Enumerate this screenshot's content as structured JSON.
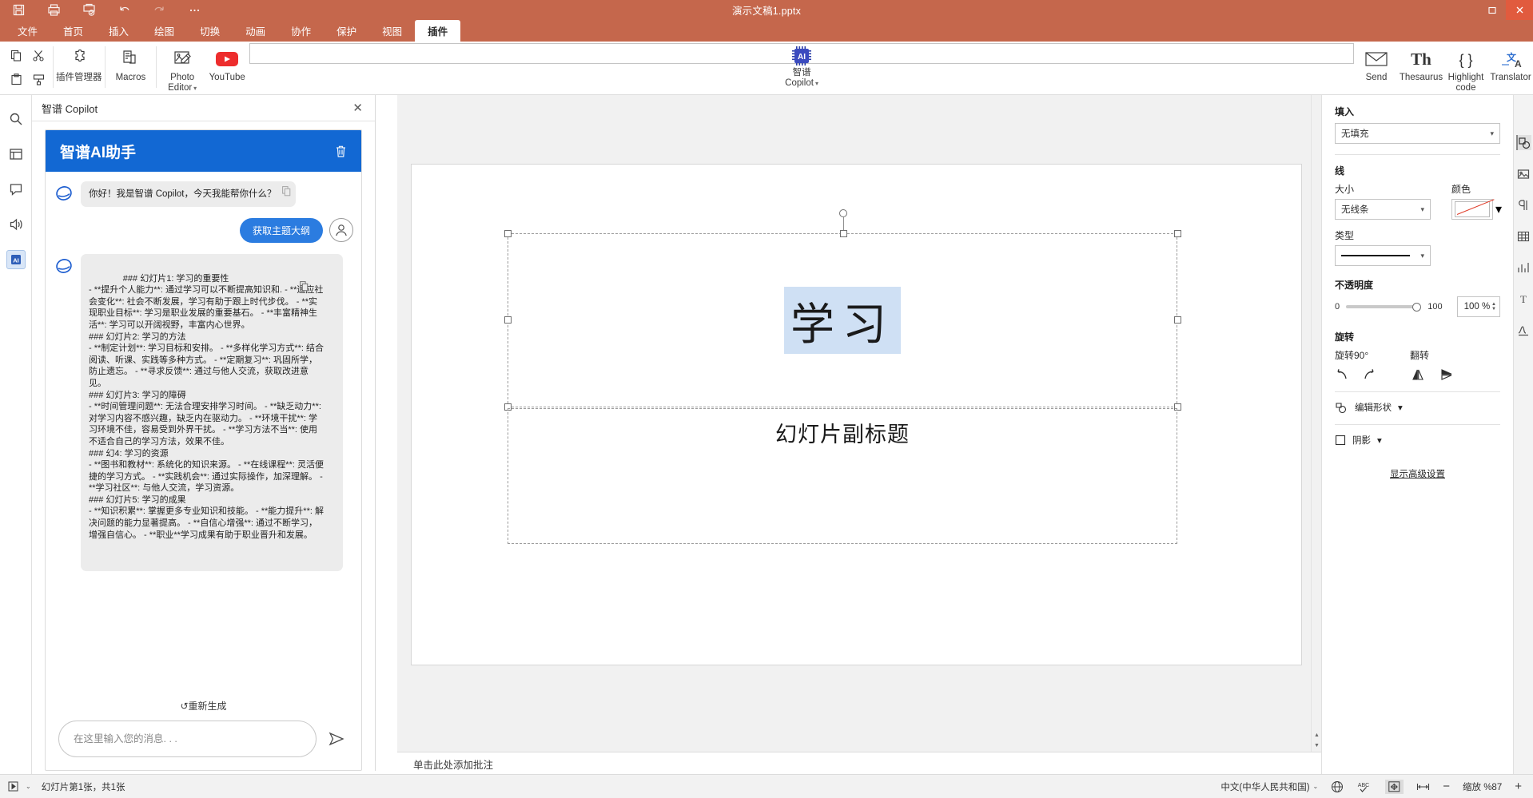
{
  "titlebar": {
    "document_title": "演示文稿1.pptx",
    "quick_access": [
      {
        "name": "save-icon",
        "label": "保存"
      },
      {
        "name": "print-icon",
        "label": "打印"
      },
      {
        "name": "print-preview-icon",
        "label": "打印预览"
      },
      {
        "name": "undo-icon",
        "label": "撤销"
      },
      {
        "name": "redo-icon",
        "label": "重做"
      },
      {
        "name": "more-icon",
        "label": "更多"
      }
    ],
    "window_buttons": [
      {
        "name": "restore-icon",
        "label": "还原"
      },
      {
        "name": "close-icon",
        "label": "关闭"
      }
    ]
  },
  "menu_tabs": [
    {
      "label": "文件",
      "active": false
    },
    {
      "label": "首页",
      "active": false
    },
    {
      "label": "插入",
      "active": false
    },
    {
      "label": "绘图",
      "active": false
    },
    {
      "label": "切换",
      "active": false
    },
    {
      "label": "动画",
      "active": false
    },
    {
      "label": "协作",
      "active": false
    },
    {
      "label": "保护",
      "active": false
    },
    {
      "label": "视图",
      "active": false
    },
    {
      "label": "插件",
      "active": true
    }
  ],
  "ribbon": {
    "clipboard": [
      {
        "name": "copy-icon",
        "label": "复制"
      },
      {
        "name": "cut-icon",
        "label": "剪切"
      },
      {
        "name": "paste-icon",
        "label": "粘贴"
      },
      {
        "name": "format-painter-icon",
        "label": "格式刷"
      }
    ],
    "items": [
      {
        "name": "plugin-manager",
        "label": "插件管理器",
        "label2": "",
        "icon": "puzzle-icon",
        "caret": false
      },
      {
        "name": "macros",
        "label": "Macros",
        "label2": "",
        "icon": "macros-icon",
        "caret": false
      },
      {
        "name": "photo-editor",
        "label": "Photo",
        "label2": "Editor",
        "icon": "photo-editor-icon",
        "caret": true
      },
      {
        "name": "youtube",
        "label": "YouTube",
        "label2": "",
        "icon": "youtube-icon",
        "caret": false
      },
      {
        "name": "zhipu-copilot",
        "label": "智谱",
        "label2": "Copilot",
        "icon": "ai-chip-icon",
        "caret": true,
        "selected": true
      },
      {
        "name": "send",
        "label": "Send",
        "label2": "",
        "icon": "envelope-icon",
        "caret": false
      },
      {
        "name": "thesaurus",
        "label": "Thesaurus",
        "label2": "",
        "icon": "thesaurus-th-icon",
        "caret": false
      },
      {
        "name": "highlight-code",
        "label": "Highlight",
        "label2": "code",
        "icon": "braces-icon",
        "caret": false
      },
      {
        "name": "translator",
        "label": "Translator",
        "label2": "",
        "icon": "translator-icon",
        "caret": false
      }
    ]
  },
  "left_rail": [
    {
      "name": "search-icon",
      "active": false
    },
    {
      "name": "slides-icon",
      "active": false
    },
    {
      "name": "comment-icon",
      "active": false
    },
    {
      "name": "audio-icon",
      "active": false
    },
    {
      "name": "ai-plugin-icon",
      "active": true
    }
  ],
  "copilot_pane": {
    "title": "智谱 Copilot",
    "close_label": "✕",
    "banner_title": "智谱AI助手",
    "delete_icon": "trash-icon",
    "messages": [
      {
        "role": "assistant",
        "text": "你好！我是智谱 Copilot，今天我能帮你什么？"
      },
      {
        "role": "user",
        "text": "获取主题大纲"
      },
      {
        "role": "assistant",
        "text": "### 幻灯片1: 学习的重要性\n- **提升个人能力**: 通过学习可以不断提高知识和. - **适应社会变化**: 社会不断发展，学习有助于跟上时代步伐。 - **实现职业目标**: 学习是职业发展的重要基石。 - **丰富精神生活**: 学习可以开阔视野，丰富内心世界。\n### 幻灯片2: 学习的方法\n- **制定计划**: 学习目标和安排。 - **多样化学习方式**: 结合阅读、听课、实践等多种方式。 - **定期复习**: 巩固所学，防止遗忘。 - **寻求反馈**: 通过与他人交流，获取改进意见。\n### 幻灯片3: 学习的障碍\n- **时间管理问题**: 无法合理安排学习时间。 - **缺乏动力**: 对学习内容不感兴趣，缺乏内在驱动力。 - **环境干扰**: 学习环境不佳，容易受到外界干扰。 - **学习方法不当**: 使用不适合自己的学习方法，效果不佳。\n### 幻4: 学习的资源\n- **图书和教材**: 系统化的知识来源。 - **在线课程**: 灵活便捷的学习方式。 - **实践机会**: 通过实际操作，加深理解。 - **学习社区**: 与他人交流，学习资源。\n### 幻灯片5: 学习的成果\n- **知识积累**: 掌握更多专业知识和技能。 - **能力提升**: 解决问题的能力显著提高。 - **自信心增强**: 通过不断学习，增强自信心。 - **职业**学习成果有助于职业晋升和发展。"
      }
    ],
    "regenerate_label": "重新生成",
    "regenerate_icon": "refresh-icon",
    "input_placeholder": "在这里输入您的消息. . .",
    "input_value": "",
    "send_icon": "send-arrow-icon"
  },
  "slide": {
    "title_placeholder": "学习",
    "subtitle_placeholder": "幻灯片副标题",
    "notes_placeholder": "单击此处添加批注"
  },
  "format_panel": {
    "fill_header": "填入",
    "fill_value": "无填充",
    "line_header": "线",
    "line_size_label": "大小",
    "line_size_value": "无线条",
    "line_color_label": "颜色",
    "line_type_label": "类型",
    "opacity_header": "不透明度",
    "opacity_min": "0",
    "opacity_max": "100",
    "opacity_value": "100 %",
    "rotate_header": "旋转",
    "rotate90_label": "旋转90°",
    "flip_label": "翻转",
    "edit_shape_label": "编辑形状",
    "shadow_label": "阴影",
    "advanced_link": "显示高级设置"
  },
  "right_rail": [
    {
      "name": "shape-settings-icon",
      "active": true
    },
    {
      "name": "image-settings-icon",
      "active": false
    },
    {
      "name": "paragraph-settings-icon",
      "active": false
    },
    {
      "name": "table-settings-icon",
      "active": false
    },
    {
      "name": "chart-settings-icon",
      "active": false
    },
    {
      "name": "text-art-icon",
      "active": false
    },
    {
      "name": "signature-icon",
      "active": false
    }
  ],
  "status_bar": {
    "present_icon": "play-icon",
    "present_caret": "⌄",
    "slide_count": "幻灯片第1张，共1张",
    "language": "中文(中华人民共和国)",
    "language_caret": "⌄",
    "globe_icon": "globe-icon",
    "spellcheck_icon": "abc-check-icon",
    "fit_slide_icon": "fit-slide-icon",
    "fit_width_icon": "fit-width-icon",
    "zoom_out": "−",
    "zoom_label": "缩放 %87",
    "zoom_in": "+"
  }
}
